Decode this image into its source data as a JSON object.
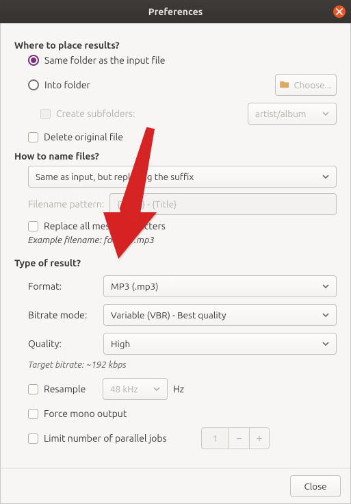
{
  "title": "Preferences",
  "section_place": {
    "heading": "Where to place results?",
    "radio_same_folder": "Same folder as the input file",
    "radio_into_folder": "Into folder",
    "choose_btn": "Choose...",
    "create_subfolders": "Create subfolders:",
    "subfolder_pattern": "artist/album",
    "delete_original": "Delete original file"
  },
  "section_name": {
    "heading": "How to name files?",
    "name_mode": "Same as input, but replacing the suffix",
    "filename_pattern_label": "Filename pattern:",
    "filename_pattern_value": "{Track} - {Title}",
    "replace_messy": "Replace all messy characters",
    "example_label": "Example filename:",
    "example_value": "foo/bar.mp3"
  },
  "section_type": {
    "heading": "Type of result?",
    "format_label": "Format:",
    "format_value": "MP3 (.mp3)",
    "bitrate_mode_label": "Bitrate mode:",
    "bitrate_mode_value": "Variable (VBR) - Best quality",
    "quality_label": "Quality:",
    "quality_value": "High",
    "target_bitrate": "Target bitrate: ~192 kbps",
    "resample_label": "Resample",
    "resample_value": "48 kHz",
    "resample_unit": "Hz",
    "force_mono": "Force mono output",
    "limit_jobs": "Limit number of parallel jobs",
    "limit_jobs_value": "1"
  },
  "footer": {
    "close": "Close"
  }
}
